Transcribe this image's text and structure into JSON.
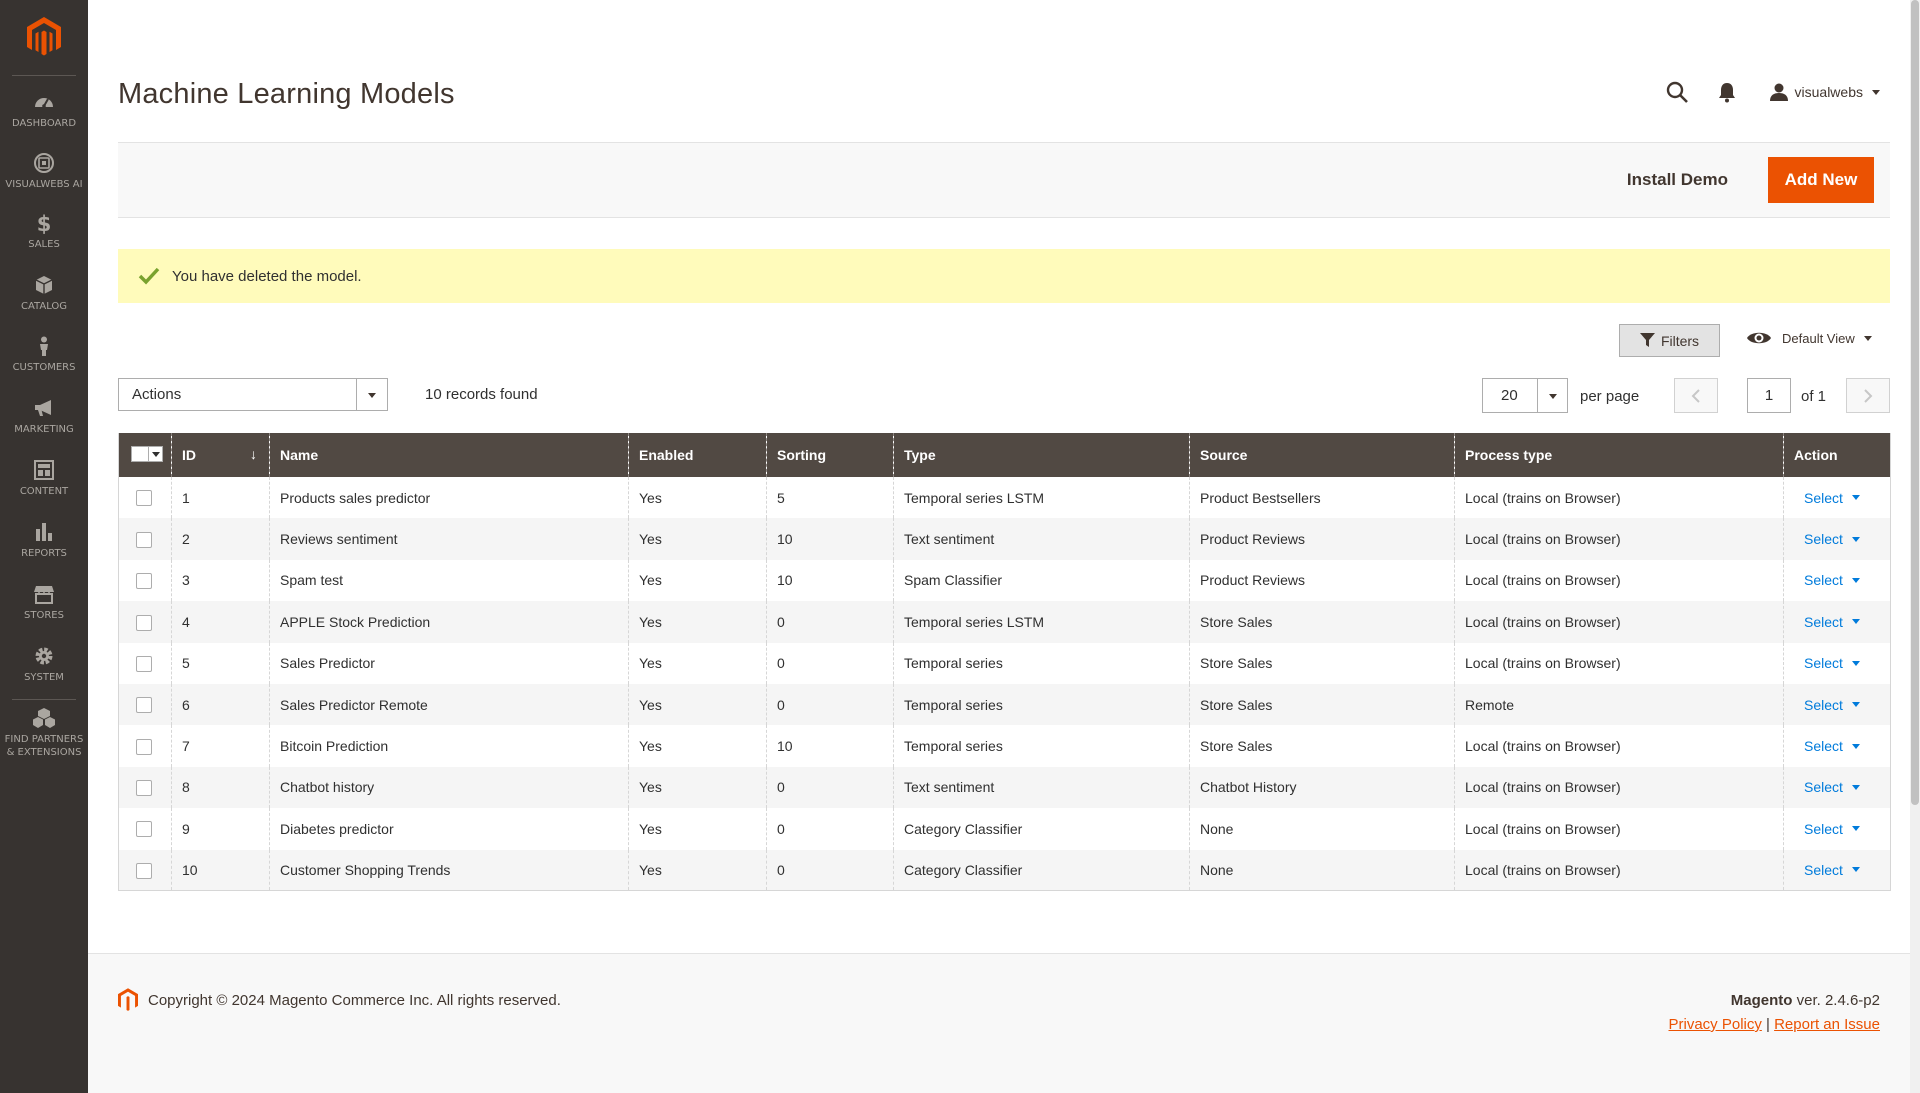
{
  "sidebar": {
    "items": [
      {
        "label": "DASHBOARD",
        "icon": "dashboard-icon"
      },
      {
        "label": "VISUALWEBS AI",
        "icon": "ai-icon"
      },
      {
        "label": "SALES",
        "icon": "dollar-icon"
      },
      {
        "label": "CATALOG",
        "icon": "box-icon"
      },
      {
        "label": "CUSTOMERS",
        "icon": "person-icon"
      },
      {
        "label": "MARKETING",
        "icon": "megaphone-icon"
      },
      {
        "label": "CONTENT",
        "icon": "layout-icon"
      },
      {
        "label": "REPORTS",
        "icon": "bar-chart-icon"
      },
      {
        "label": "STORES",
        "icon": "storefront-icon"
      },
      {
        "label": "SYSTEM",
        "icon": "gear-icon"
      }
    ],
    "partners_line1": "FIND PARTNERS",
    "partners_line2": "& EXTENSIONS"
  },
  "header": {
    "title": "Machine Learning Models",
    "username": "visualwebs"
  },
  "action_bar": {
    "install_demo": "Install Demo",
    "add_new": "Add New"
  },
  "message": {
    "text": "You have deleted the model."
  },
  "grid_toolbar": {
    "filters": "Filters",
    "default_view": "Default View",
    "actions": "Actions",
    "records_found": "10 records found",
    "per_page_value": "20",
    "per_page_label": "per page",
    "current_page": "1",
    "of_pages": "of 1"
  },
  "table": {
    "columns": [
      "ID",
      "Name",
      "Enabled",
      "Sorting",
      "Type",
      "Source",
      "Process type",
      "Action"
    ],
    "action_label": "Select",
    "rows": [
      {
        "id": "1",
        "name": "Products sales predictor",
        "enabled": "Yes",
        "sorting": "5",
        "type": "Temporal series LSTM",
        "source": "Product Bestsellers",
        "process": "Local (trains on Browser)"
      },
      {
        "id": "2",
        "name": "Reviews sentiment",
        "enabled": "Yes",
        "sorting": "10",
        "type": "Text sentiment",
        "source": "Product Reviews",
        "process": "Local (trains on Browser)"
      },
      {
        "id": "3",
        "name": "Spam test",
        "enabled": "Yes",
        "sorting": "10",
        "type": "Spam Classifier",
        "source": "Product Reviews",
        "process": "Local (trains on Browser)"
      },
      {
        "id": "4",
        "name": "APPLE Stock Prediction",
        "enabled": "Yes",
        "sorting": "0",
        "type": "Temporal series LSTM",
        "source": "Store Sales",
        "process": "Local (trains on Browser)"
      },
      {
        "id": "5",
        "name": "Sales Predictor",
        "enabled": "Yes",
        "sorting": "0",
        "type": "Temporal series",
        "source": "Store Sales",
        "process": "Local (trains on Browser)"
      },
      {
        "id": "6",
        "name": "Sales Predictor Remote",
        "enabled": "Yes",
        "sorting": "0",
        "type": "Temporal series",
        "source": "Store Sales",
        "process": "Remote"
      },
      {
        "id": "7",
        "name": "Bitcoin Prediction",
        "enabled": "Yes",
        "sorting": "10",
        "type": "Temporal series",
        "source": "Store Sales",
        "process": "Local (trains on Browser)"
      },
      {
        "id": "8",
        "name": "Chatbot history",
        "enabled": "Yes",
        "sorting": "0",
        "type": "Text sentiment",
        "source": "Chatbot History",
        "process": "Local (trains on Browser)"
      },
      {
        "id": "9",
        "name": "Diabetes predictor",
        "enabled": "Yes",
        "sorting": "0",
        "type": "Category Classifier",
        "source": "None",
        "process": "Local (trains on Browser)"
      },
      {
        "id": "10",
        "name": "Customer Shopping Trends",
        "enabled": "Yes",
        "sorting": "0",
        "type": "Category Classifier",
        "source": "None",
        "process": "Local (trains on Browser)"
      }
    ]
  },
  "footer": {
    "copyright": "Copyright © 2024 Magento Commerce Inc. All rights reserved.",
    "brand": "Magento",
    "version": " ver. 2.4.6-p2",
    "privacy": "Privacy Policy",
    "separator": " | ",
    "report": "Report an Issue"
  },
  "colors": {
    "sidebar_bg": "#373330",
    "accent": "#eb5202",
    "table_header": "#514943",
    "link": "#007bdb",
    "message_bg": "#fffbbb"
  }
}
